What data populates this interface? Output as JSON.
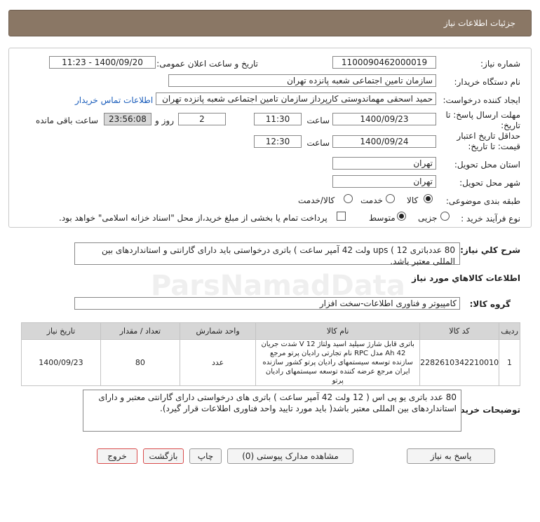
{
  "header": {
    "title": "جزئیات اطلاعات نیاز"
  },
  "form": {
    "need_number_label": "شماره نیاز:",
    "need_number": "1100090462000019",
    "announce_label": "تاریخ و ساعت اعلان عمومی:",
    "announce_value": "1400/09/20 - 11:23",
    "buyer_org_label": "نام دستگاه خریدار:",
    "buyer_org": "سازمان تامین اجتماعی شعبه پانزده تهران",
    "creator_label": "ایجاد کننده درخواست:",
    "creator": "حمید اسحقی مهماندوستی کارپرداز سازمان تامین اجتماعی شعبه پانزده تهران",
    "contact_link": "اطلاعات تماس خریدار",
    "deadline_label": "مهلت ارسال پاسخ: تا",
    "deadline_label2": "تاریخ:",
    "deadline_date": "1400/09/23",
    "time_label": "ساعت",
    "deadline_time": "11:30",
    "days_value": "2",
    "days_label": "روز و",
    "remaining_value": "23:56:08",
    "remaining_label": "ساعت باقی مانده",
    "validity_label": "حداقل تاریخ اعتبار",
    "validity_label2": "قیمت: تا تاریخ:",
    "validity_date": "1400/09/24",
    "validity_time": "12:30",
    "province_label": "استان محل تحویل:",
    "province": "تهران",
    "city_label": "شهر محل تحویل:",
    "city": "تهران",
    "category_label": "طبقه بندی موضوعی:",
    "cat_goods": "کالا",
    "cat_service": "خدمت",
    "cat_goods_service": "کالا/خدمت",
    "process_label": "نوع فرآیند خرید :",
    "proc_partial": "جزیی",
    "proc_medium": "متوسط",
    "payment_note": "پرداخت تمام یا بخشی از مبلغ خرید،از محل \"اسناد خزانه اسلامی\" خواهد بود."
  },
  "summary": {
    "label": "شرح کلي نياز:",
    "text": "80 عددباتری 12 ) ups ولت 42 آمپر ساعت ) باتری درخواستی باید دارای گارانتی و استانداردهای بین المللی معتبر باشد."
  },
  "goods_info_title": "اطلاعات کالاهاي مورد نياز",
  "goods_group": {
    "label": "گروه کالا:",
    "value": "کامپیوتر و فناوری اطلاعات-سخت افزار"
  },
  "table": {
    "headers": [
      "ردیف",
      "کد کالا",
      "نام کالا",
      "واحد شمارش",
      "تعداد / مقدار",
      "تاریخ نیاز"
    ],
    "rows": [
      {
        "index": "1",
        "code": "2282610342210010",
        "name": "باتری قابل شارژ سیلید اسید ولتاژ 12 V شدت جریان 42 Ah مدل RPC نام تجارتی رادیان پرتو مرجع سازنده توسعه سیستمهای رادیان پرتو کشور سازنده ایران مرجع عرضه کننده توسعه سیستمهای رادیان پرتو",
        "unit": "عدد",
        "qty": "80",
        "date": "1400/09/23"
      }
    ]
  },
  "buyer_notes": {
    "label": "توضیحات خریدار:",
    "text": "80 عدد باتری یو پی اس ( 12 ولت 42 آمپر ساعت ) باتری های درخواستی دارای گارانتی معتبر و دارای استانداردهای بین المللی معتبر باشد( باید مورد تایید واحد فناوری اطلاعات قرار گیرد)."
  },
  "buttons": {
    "reply": "پاسخ به نیاز",
    "attachments": "مشاهده مدارک پیوستی (0)",
    "print": "چاپ",
    "back": "بازگشت",
    "exit": "خروج"
  }
}
